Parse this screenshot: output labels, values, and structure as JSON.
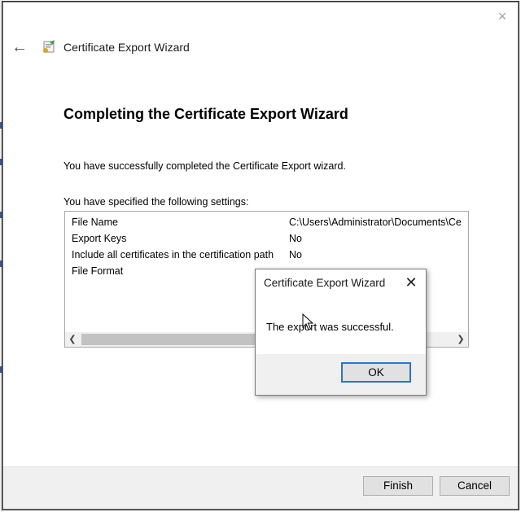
{
  "window": {
    "header_title": "Certificate Export Wizard",
    "close_glyph": "×",
    "back_glyph": "←"
  },
  "main": {
    "title": "Completing the Certificate Export Wizard",
    "success_text": "You have successfully completed the Certificate Export wizard.",
    "specified_text": "You have specified the following settings:"
  },
  "settings": [
    {
      "key": "File Name",
      "value": "C:\\Users\\Administrator\\Documents\\Ce"
    },
    {
      "key": "Export Keys",
      "value": "No"
    },
    {
      "key": "Include all certificates in the certification path",
      "value": "No"
    },
    {
      "key": "File Format",
      "value": ""
    }
  ],
  "footer": {
    "finish_label": "Finish",
    "cancel_label": "Cancel"
  },
  "popup": {
    "title": "Certificate Export Wizard",
    "message": "The export was successful.",
    "ok_label": "OK",
    "close_glyph": "✕"
  },
  "icons": {
    "back": "back-arrow-icon",
    "wizard": "certificate-icon",
    "close": "close-icon",
    "cursor": "mouse-cursor-icon"
  },
  "colors": {
    "accent_focus": "#2a74d0",
    "button_bg": "#e1e1e1",
    "footer_bg": "#f0f0f0"
  }
}
